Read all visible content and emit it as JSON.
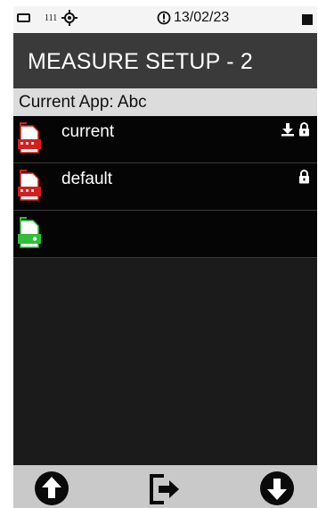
{
  "status": {
    "channel": "111",
    "date": "13/02/23"
  },
  "header": {
    "title": "MEASURE SETUP - 2"
  },
  "app": {
    "label": "Current App: Abc"
  },
  "list": {
    "items": [
      {
        "label": "current",
        "icon": "red-file-icon",
        "downloaded": true,
        "locked": true
      },
      {
        "label": "default",
        "icon": "red-file-icon",
        "downloaded": false,
        "locked": true
      },
      {
        "label": "",
        "icon": "green-file-icon",
        "downloaded": false,
        "locked": false
      }
    ]
  },
  "footer": {
    "buttons": [
      "arrow-up-icon",
      "exit-icon",
      "arrow-down-icon"
    ]
  },
  "colors": {
    "title_bar": "#3a3a3a",
    "list_bg": "#050505",
    "file_red": "#d21f1f",
    "file_green": "#2fbf3a"
  }
}
